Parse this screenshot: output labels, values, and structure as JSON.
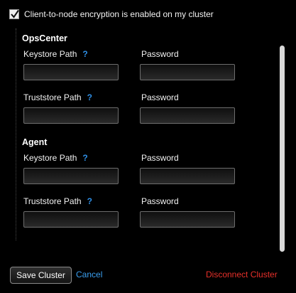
{
  "encryption": {
    "checked": true,
    "label": "Client-to-node encryption is enabled on my cluster"
  },
  "groups": [
    {
      "title": "OpsCenter",
      "rows": [
        {
          "path_label": "Keystore Path",
          "help": "?",
          "password_label": "Password",
          "path_value": "",
          "password_value": ""
        },
        {
          "path_label": "Truststore Path",
          "help": "?",
          "password_label": "Password",
          "path_value": "",
          "password_value": ""
        }
      ]
    },
    {
      "title": "Agent",
      "rows": [
        {
          "path_label": "Keystore Path",
          "help": "?",
          "password_label": "Password",
          "path_value": "",
          "password_value": ""
        },
        {
          "path_label": "Truststore Path",
          "help": "?",
          "password_label": "Password",
          "path_value": "",
          "password_value": ""
        }
      ]
    }
  ],
  "footer": {
    "save_label": "Save Cluster",
    "cancel_label": "Cancel",
    "disconnect_label": "Disconnect Cluster"
  },
  "colors": {
    "background": "#000000",
    "link": "#3a9ff0",
    "help": "#2f8fe6",
    "danger": "#e8302a"
  },
  "icons": {
    "checkbox": "checkmark-icon",
    "help": "question-mark-icon"
  }
}
